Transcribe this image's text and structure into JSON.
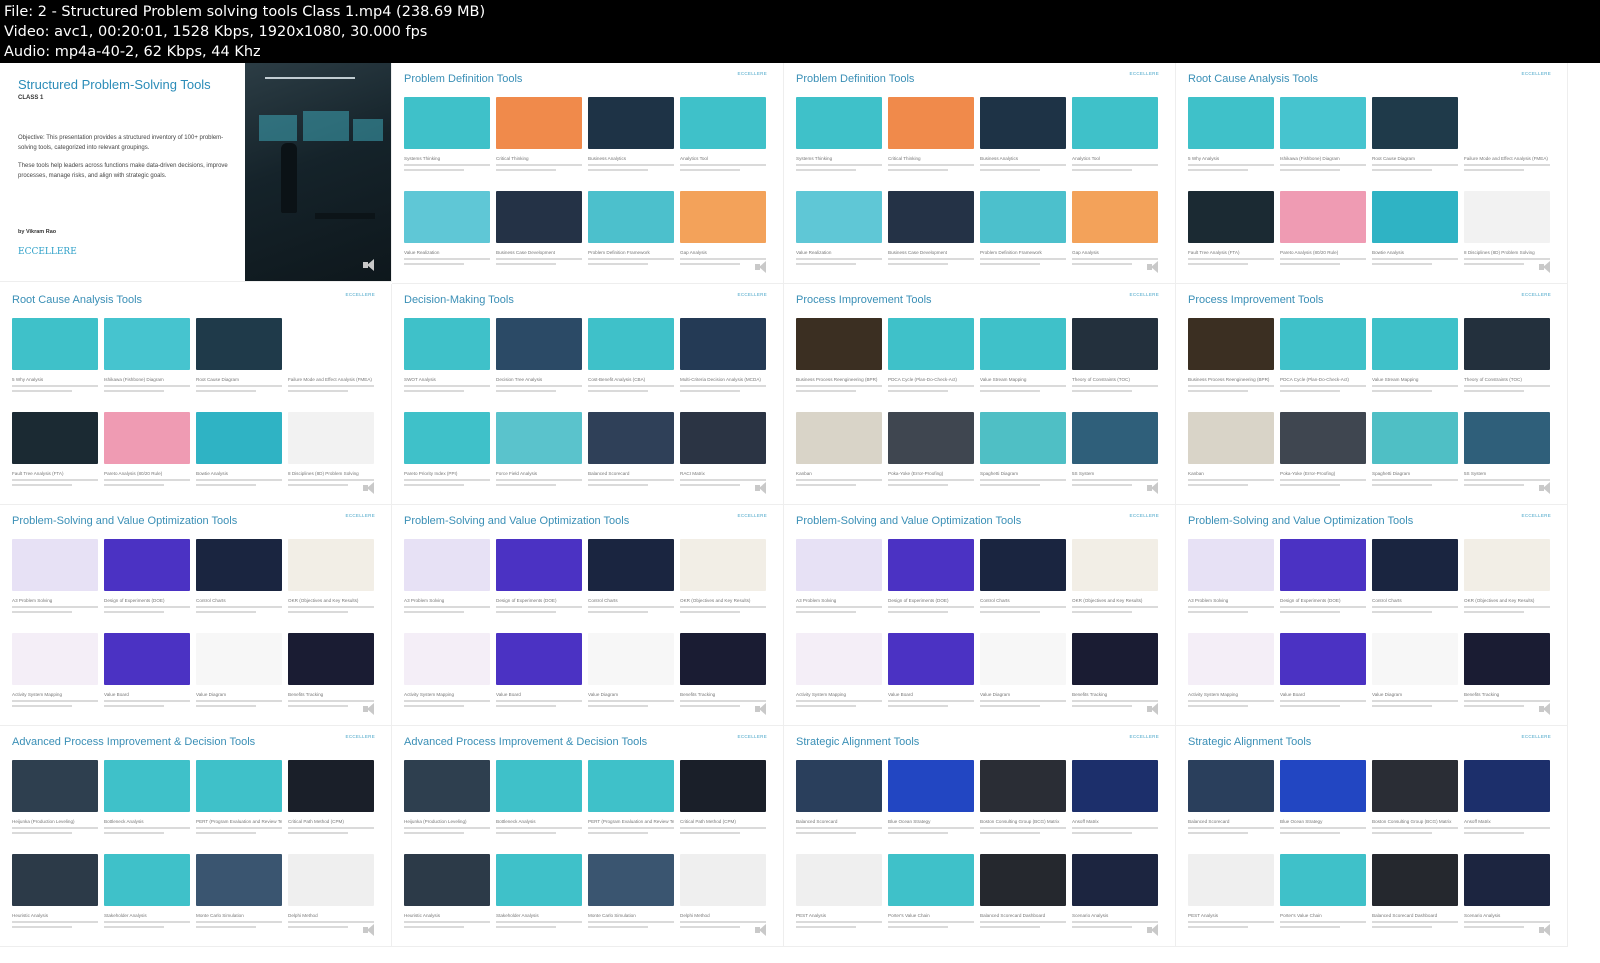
{
  "file_info": {
    "line1": "File: 2 - Structured Problem solving tools Class 1.mp4 (238.69 MB)",
    "line2": "Video: avc1, 00:20:01, 1528 Kbps, 1920x1080, 30.000 fps",
    "line3": "Audio: mp4a-40-2, 62 Kbps, 44 Khz"
  },
  "brand": "ECCELLERE",
  "cover": {
    "title": "Structured Problem-Solving Tools",
    "class_label": "CLASS 1",
    "objective": "Objective: This presentation provides a structured inventory of 100+ problem-solving tools, categorized into relevant groupings.",
    "purpose": "These tools help leaders across functions make data-driven decisions, improve processes, manage risks, and align with strategic goals.",
    "author": "by Vikram Rao",
    "brand_name": "ECCELLERE"
  },
  "slides": [
    {
      "title": "Problem Definition Tools",
      "tiles": [
        "Systems Thinking",
        "Critical Thinking",
        "Business Analytics",
        "Analytics Tool",
        "Value Realization",
        "Business Case Development",
        "Problem Definition Framework",
        "Gap Analysis"
      ]
    },
    {
      "title": "Problem Definition Tools",
      "tiles": [
        "Systems Thinking",
        "Critical Thinking",
        "Business Analytics",
        "Analytics Tool",
        "Value Realization",
        "Business Case Development",
        "Problem Definition Framework",
        "Gap Analysis"
      ]
    },
    {
      "title": "Root Cause Analysis Tools",
      "tiles": [
        "5 Why Analysis",
        "Ishikawa (Fishbone) Diagram",
        "Root Cause Diagram",
        "Failure Mode and Effect Analysis (FMEA)",
        "Fault Tree Analysis (FTA)",
        "Pareto Analysis (80/20 Rule)",
        "Bowtie Analysis",
        "8 Disciplines (8D) Problem Solving"
      ]
    },
    {
      "title": "Root Cause Analysis Tools",
      "tiles": [
        "5 Why Analysis",
        "Ishikawa (Fishbone) Diagram",
        "Root Cause Diagram",
        "Failure Mode and Effect Analysis (FMEA)",
        "Fault Tree Analysis (FTA)",
        "Pareto Analysis (80/20 Rule)",
        "Bowtie Analysis",
        "8 Disciplines (8D) Problem Solving"
      ]
    },
    {
      "title": "Decision-Making Tools",
      "tiles": [
        "SWOT Analysis",
        "Decision Tree Analysis",
        "Cost-Benefit Analysis (CBA)",
        "Multi-Criteria Decision Analysis (MCDA)",
        "Pareto Priority Index (PPI)",
        "Force Field Analysis",
        "Balanced Scorecard",
        "RACI Matrix"
      ]
    },
    {
      "title": "Process Improvement Tools",
      "tiles": [
        "Business Process Reengineering (BPR)",
        "PDCA Cycle (Plan-Do-Check-Act)",
        "Value Stream Mapping",
        "Theory of Constraints (TOC)",
        "Kanban",
        "Poka-Yoke (Error-Proofing)",
        "Spaghetti Diagram",
        "5S System"
      ]
    },
    {
      "title": "Process Improvement Tools",
      "tiles": [
        "Business Process Reengineering (BPR)",
        "PDCA Cycle (Plan-Do-Check-Act)",
        "Value Stream Mapping",
        "Theory of Constraints (TOC)",
        "Kanban",
        "Poka-Yoke (Error-Proofing)",
        "Spaghetti Diagram",
        "5S System"
      ]
    },
    {
      "title": "Problem-Solving and Value Optimization Tools",
      "tiles": [
        "A3 Problem Solving",
        "Design of Experiments (DOE)",
        "Control Charts",
        "OKR (Objectives and Key Results)",
        "Activity System Mapping",
        "Value Board",
        "Value Diagram",
        "Benefits Tracking"
      ]
    },
    {
      "title": "Problem-Solving and Value Optimization Tools",
      "tiles": [
        "A3 Problem Solving",
        "Design of Experiments (DOE)",
        "Control Charts",
        "OKR (Objectives and Key Results)",
        "Activity System Mapping",
        "Value Board",
        "Value Diagram",
        "Benefits Tracking"
      ]
    },
    {
      "title": "Problem-Solving and Value Optimization Tools",
      "tiles": [
        "A3 Problem Solving",
        "Design of Experiments (DOE)",
        "Control Charts",
        "OKR (Objectives and Key Results)",
        "Activity System Mapping",
        "Value Board",
        "Value Diagram",
        "Benefits Tracking"
      ]
    },
    {
      "title": "Problem-Solving and Value Optimization Tools",
      "tiles": [
        "A3 Problem Solving",
        "Design of Experiments (DOE)",
        "Control Charts",
        "OKR (Objectives and Key Results)",
        "Activity System Mapping",
        "Value Board",
        "Value Diagram",
        "Benefits Tracking"
      ]
    },
    {
      "title": "Advanced Process Improvement & Decision Tools",
      "tiles": [
        "Heijunka (Production Leveling)",
        "Bottleneck Analysis",
        "PERT (Program Evaluation and Review Technique)",
        "Critical Path Method (CPM)",
        "Heuristic Analysis",
        "Stakeholder Analysis",
        "Monte Carlo Simulation",
        "Delphi Method"
      ]
    },
    {
      "title": "Advanced Process Improvement & Decision Tools",
      "tiles": [
        "Heijunka (Production Leveling)",
        "Bottleneck Analysis",
        "PERT (Program Evaluation and Review Technique)",
        "Critical Path Method (CPM)",
        "Heuristic Analysis",
        "Stakeholder Analysis",
        "Monte Carlo Simulation",
        "Delphi Method"
      ]
    },
    {
      "title": "Strategic Alignment Tools",
      "tiles": [
        "Balanced Scorecard",
        "Blue Ocean Strategy",
        "Boston Consulting Group (BCG) Matrix",
        "Ansoff Matrix",
        "PEST Analysis",
        "Porter's Value Chain",
        "Balanced Scorecard Dashboard",
        "Scenario Analysis"
      ]
    },
    {
      "title": "Strategic Alignment Tools",
      "tiles": [
        "Balanced Scorecard",
        "Blue Ocean Strategy",
        "Boston Consulting Group (BCG) Matrix",
        "Ansoff Matrix",
        "PEST Analysis",
        "Porter's Value Chain",
        "Balanced Scorecard Dashboard",
        "Scenario Analysis"
      ]
    }
  ],
  "colors": {
    "title_blue": "#3a8fb6",
    "teal": "#3fc1c9",
    "dark_navy": "#1d2c3a",
    "purple": "#4b32c3"
  }
}
